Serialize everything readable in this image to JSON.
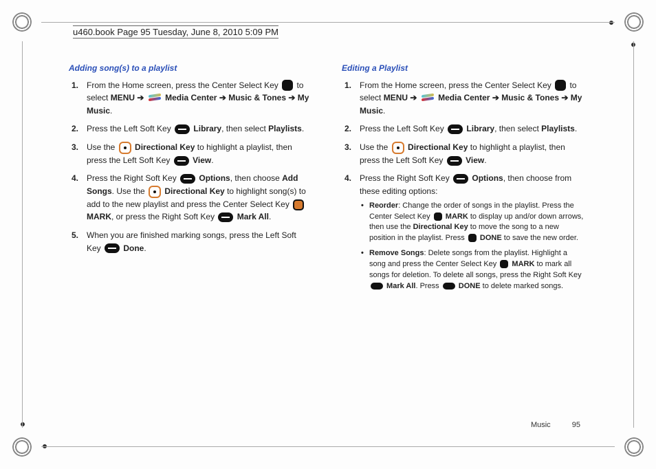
{
  "header": "u460.book  Page 95  Tuesday, June 8, 2010  5:09 PM",
  "left": {
    "title": "Adding song(s) to a playlist",
    "s1_a": "From the Home screen, press the Center Select Key ",
    "s1_b": " to select ",
    "s1_menu": "MENU",
    "s1_mc": " Media Center ",
    "s1_mt": " Music & Tones ",
    "s1_mm": "My Music",
    "s2_a": "Press the Left Soft Key ",
    "s2_lib": " Library",
    "s2_b": ", then select ",
    "s2_pl": "Playlists",
    "s3_a": "Use the ",
    "s3_dk": " Directional Key",
    "s3_b": " to highlight a playlist, then press the Left Soft Key ",
    "s3_view": " View",
    "s4_a": "Press the Right Soft Key ",
    "s4_opt": " Options",
    "s4_b": ", then choose ",
    "s4_add": "Add Songs",
    "s4_c": ". Use the ",
    "s4_dk": " Directional Key",
    "s4_d": " to highlight song(s) to add to the new playlist and press the Center Select Key ",
    "s4_mark": " MARK",
    "s4_e": ", or press the Right Soft Key ",
    "s4_ma": " Mark All",
    "s5_a": "When you are finished marking songs, press the Left Soft Key ",
    "s5_done": " Done"
  },
  "right": {
    "title": "Editing a Playlist",
    "s1_a": "From the Home screen, press the Center Select Key ",
    "s1_b": " to select ",
    "s1_menu": "MENU",
    "s1_mc": " Media Center ",
    "s1_mt": " Music & Tones ",
    "s1_mm": "My Music",
    "s2_a": "Press the Left Soft Key ",
    "s2_lib": " Library",
    "s2_b": ", then select ",
    "s2_pl": "Playlists",
    "s3_a": "Use the ",
    "s3_dk": " Directional Key",
    "s3_b": " to highlight a playlist, then press the Left Soft Key ",
    "s3_view": " View",
    "s4_a": "Press the Right Soft Key ",
    "s4_opt": " Options",
    "s4_b": ", then choose from these editing options:",
    "b1_t": "Reorder",
    "b1_a": ": Change the order of songs in the playlist. Press the Center Select Key ",
    "b1_mark": " MARK",
    "b1_b": " to display up and/or down arrows, then use the ",
    "b1_dk": "Directional Key",
    "b1_c": " to move the song to a new position in the playlist. Press ",
    "b1_done": " DONE",
    "b1_d": " to save the new order.",
    "b2_t": "Remove Songs",
    "b2_a": ": Delete songs from the playlist. Highlight a song and press the Center Select Key ",
    "b2_mark": " MARK",
    "b2_b": " to mark all songs for deletion. To delete all songs, press the Right Soft Key ",
    "b2_ma": " Mark All",
    "b2_c": ". Press ",
    "b2_done": " DONE",
    "b2_d": " to delete marked songs."
  },
  "footer": {
    "section": "Music",
    "page": "95"
  }
}
